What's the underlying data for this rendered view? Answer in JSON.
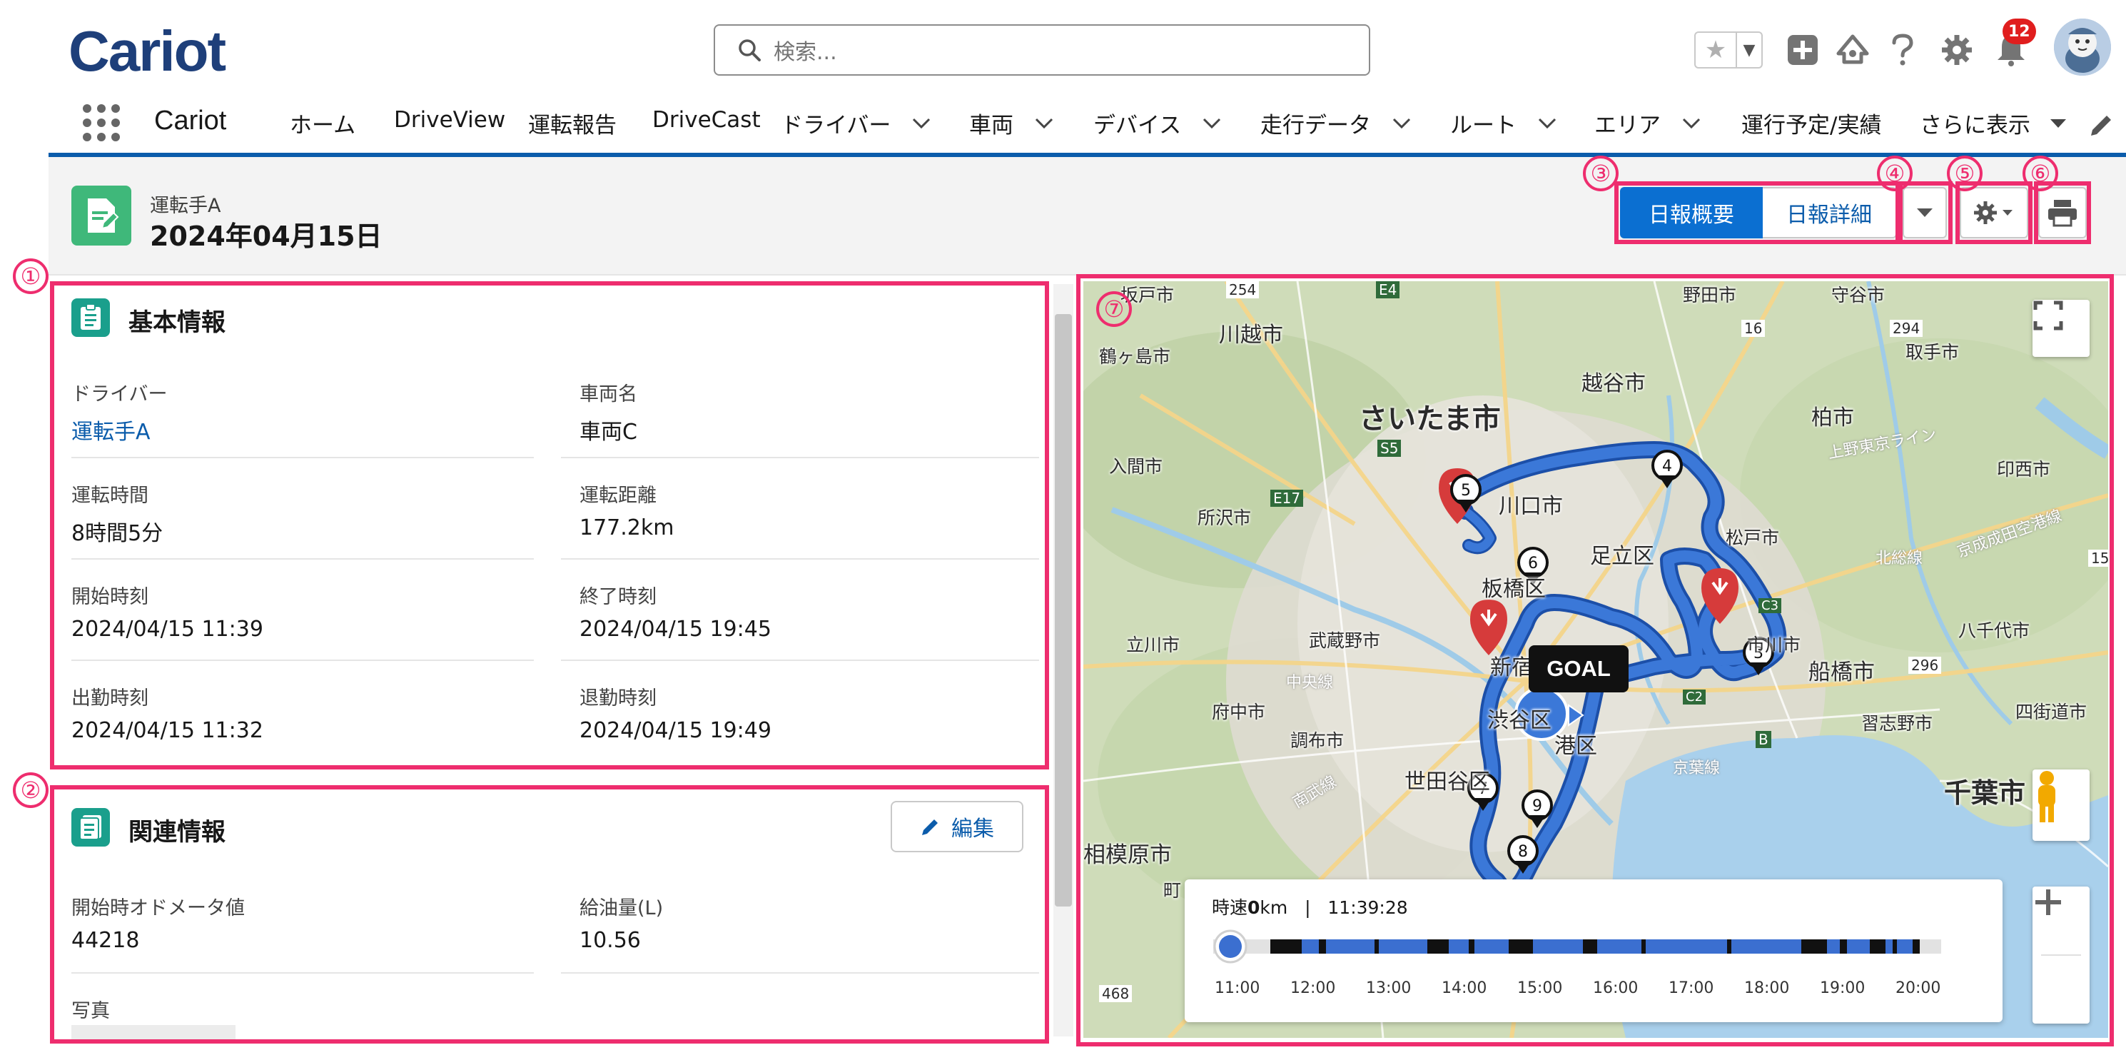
{
  "header": {
    "logo_text": "Cariot",
    "search_placeholder": "検索...",
    "notification_count": "12"
  },
  "nav": {
    "app_name": "Cariot",
    "items": [
      {
        "label": "ホーム"
      },
      {
        "label": "DriveView"
      },
      {
        "label": "運転報告"
      },
      {
        "label": "DriveCast"
      },
      {
        "label": "ドライバー"
      },
      {
        "label": "車両"
      },
      {
        "label": "デバイス"
      },
      {
        "label": "走行データ"
      },
      {
        "label": "ルート"
      },
      {
        "label": "エリア"
      },
      {
        "label": "運行予定/実績"
      },
      {
        "label": "さらに表示"
      }
    ]
  },
  "record": {
    "subtitle": "運転手A",
    "title": "2024年04月15日",
    "btn_summary": "日報概要",
    "btn_detail": "日報詳細"
  },
  "callouts": [
    "①",
    "②",
    "③",
    "④",
    "⑤",
    "⑥",
    "⑦"
  ],
  "basic_info": {
    "title": "基本情報",
    "fields": [
      {
        "label": "ドライバー",
        "value": "運転手A"
      },
      {
        "label": "車両名",
        "value": "車両C"
      },
      {
        "label": "運転時間",
        "value": "8時間5分"
      },
      {
        "label": "運転距離",
        "value": "177.2km"
      },
      {
        "label": "開始時刻",
        "value": "2024/04/15 11:39"
      },
      {
        "label": "終了時刻",
        "value": "2024/04/15 19:45"
      },
      {
        "label": "出勤時刻",
        "value": "2024/04/15 11:32"
      },
      {
        "label": "退勤時刻",
        "value": "2024/04/15 19:49"
      }
    ]
  },
  "related_info": {
    "title": "関連情報",
    "edit_label": "編集",
    "fields": [
      {
        "label": "開始時オドメータ値",
        "value": "44218"
      },
      {
        "label": "給油量(L)",
        "value": "10.56"
      },
      {
        "label": "写真",
        "value": ""
      }
    ]
  },
  "map": {
    "goal_label": "GOAL",
    "markers": [
      "3",
      "4",
      "5",
      "6",
      "7",
      "8",
      "9"
    ],
    "places": [
      "坂戸市",
      "川越市",
      "鶴ヶ島市",
      "さいたま市",
      "越谷市",
      "柏市",
      "野田市",
      "守谷市",
      "取手市",
      "印西市",
      "入間市",
      "所沢市",
      "川口市",
      "足立区",
      "松戸市",
      "板橋区",
      "市川市",
      "立川市",
      "武蔵野市",
      "新宿区",
      "船橋市",
      "八千代市",
      "府中市",
      "渋谷区",
      "港区",
      "四街道市",
      "習志野市",
      "調布市",
      "世田谷区",
      "千葉市",
      "相模原市",
      "町"
    ],
    "roads": [
      "254",
      "E4",
      "16",
      "294",
      "S5",
      "E17",
      "中央線",
      "C2",
      "C3",
      "296",
      "B",
      "京葉線",
      "南武線",
      "468",
      "北総線",
      "上野東京ライン",
      "京成成田空港線",
      "15"
    ],
    "timeline": {
      "speed_prefix": "時速",
      "speed_value": "0",
      "speed_unit": "km",
      "separator": "|",
      "time": "11:39:28",
      "ticks": [
        "11:00",
        "12:00",
        "13:00",
        "14:00",
        "15:00",
        "16:00",
        "17:00",
        "18:00",
        "19:00",
        "20:00"
      ],
      "playhead_time": "11:00"
    }
  },
  "colors": {
    "brand": "#1e3f7a",
    "primary": "#0b6fd1",
    "highlight": "#ee2d6e",
    "route": "#2f6fd6",
    "record_icon": "#3fb87a",
    "card_icon": "#1a9f8c"
  }
}
